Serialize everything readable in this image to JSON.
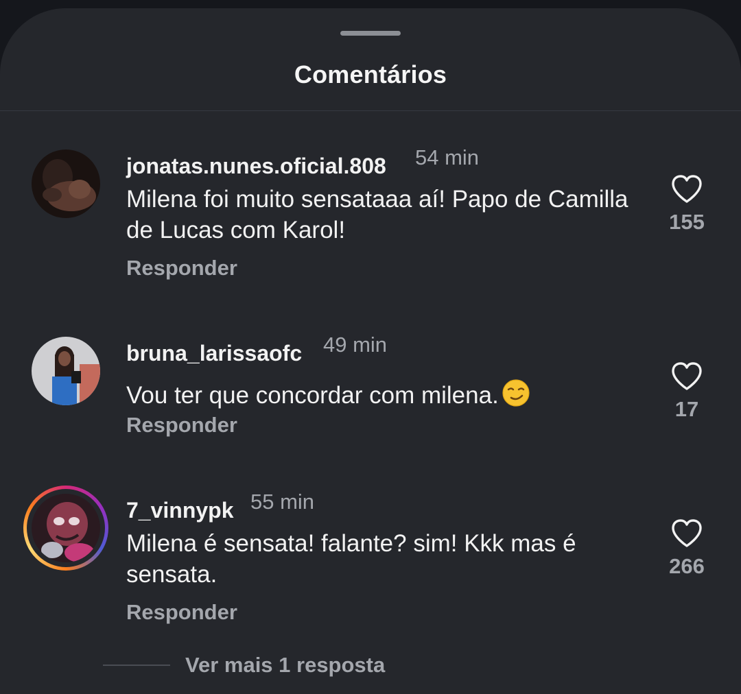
{
  "header": {
    "title": "Comentários"
  },
  "comments": [
    {
      "username": "jonatas.nunes.oficial.808",
      "time": "54 min",
      "text": "Milena foi muito sensataaa aí! Papo de Camilla de Lucas com Karol!",
      "reply_label": "Responder",
      "likes": "155",
      "avatar": "profile-photo-dark-shirtless-man"
    },
    {
      "username": "bruna_larissaofc",
      "time": "49 min",
      "text": "Vou ter que concordar com milena.",
      "emoji": "smirking-face-emoji",
      "reply_label": "Responder",
      "likes": "17",
      "avatar": "profile-photo-woman-mirror-selfie"
    },
    {
      "username": "7_vinnypk",
      "time": "55 min",
      "text": "Milena é sensata! falante? sim! Kkk mas é sensata.",
      "reply_label": "Responder",
      "likes": "266",
      "avatar": "profile-photo-chucky-doll",
      "has_story_ring": true
    }
  ],
  "view_more_replies": "Ver mais 1 resposta",
  "icons": {
    "like": "heart-outline-icon",
    "handle": "drag-handle"
  },
  "colors": {
    "sheet_bg": "#25272c",
    "primary_text": "#f2f2f2",
    "secondary_text": "#a4a7ad"
  }
}
